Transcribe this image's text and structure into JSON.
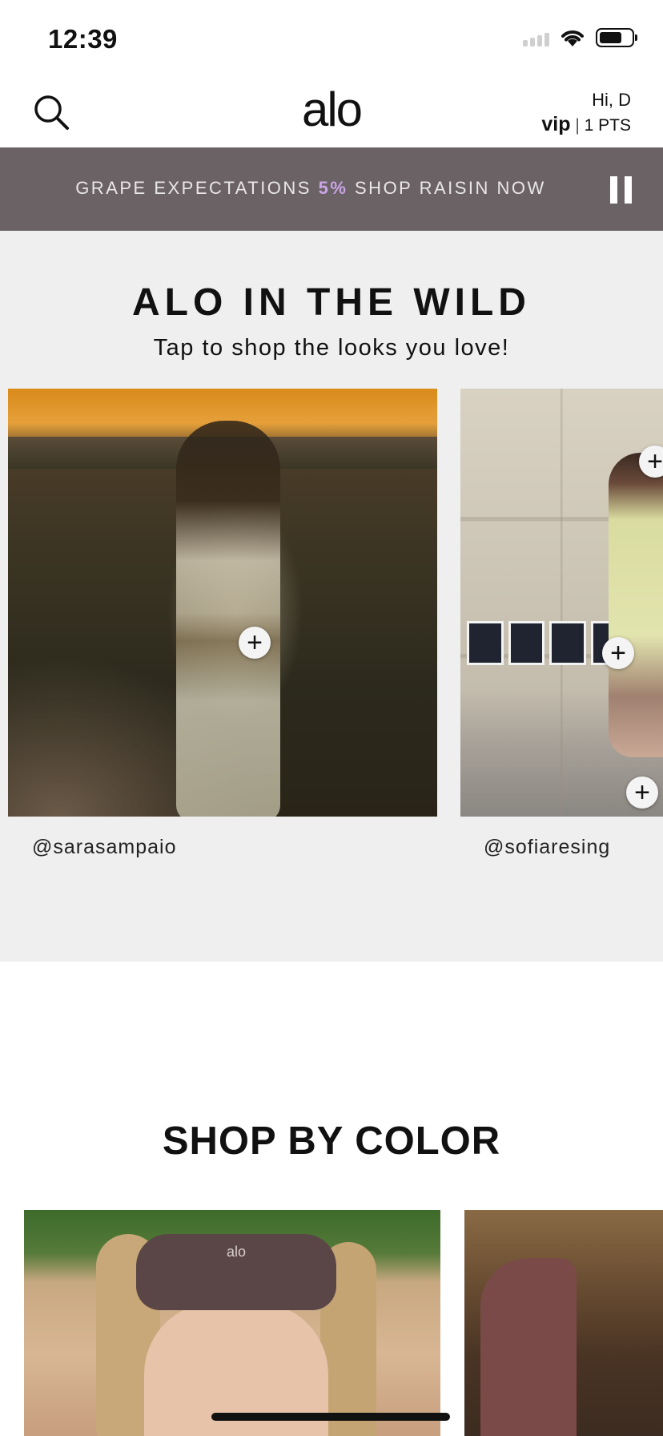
{
  "status_bar": {
    "time": "12:39"
  },
  "header": {
    "logo": "alo",
    "greeting": "Hi, D",
    "vip_label": "vip",
    "separator": "|",
    "points": "1 PTS"
  },
  "banner": {
    "text_before": "GRAPE EXPECTATIONS ",
    "highlight": "5%",
    "text_after": " SHOP RAISIN NOW"
  },
  "wild": {
    "title": "ALO IN THE WILD",
    "subtitle": "Tap to shop the looks you love!",
    "cards": [
      {
        "handle": "@sarasampaio"
      },
      {
        "handle": "@sofiaresing"
      }
    ],
    "plus_symbol": "+"
  },
  "shop_by_color": {
    "title": "SHOP BY COLOR",
    "card1_logo": "alo"
  },
  "colors": {
    "banner_bg": "#6b6266",
    "section_bg": "#efefef"
  }
}
